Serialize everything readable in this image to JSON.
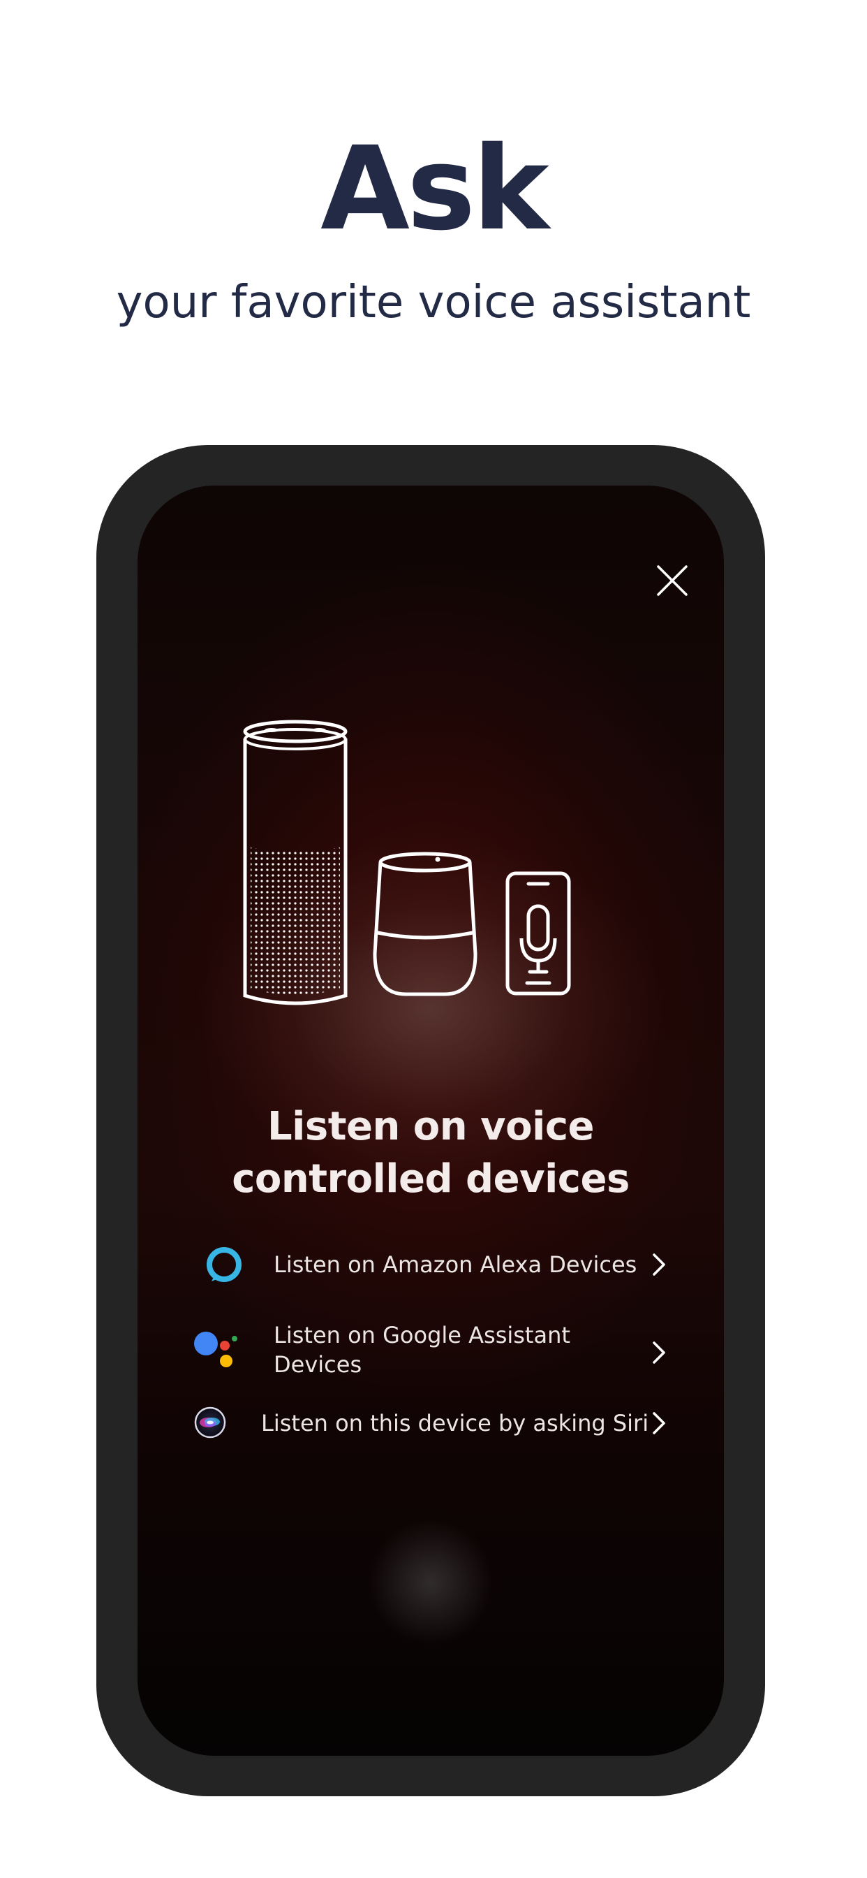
{
  "header": {
    "title": "Ask",
    "subtitle": "your favorite voice assistant"
  },
  "device_screen": {
    "title_line1": "Listen on voice",
    "title_line2": "controlled devices",
    "close_icon": "close-icon",
    "illustration_icons": [
      "smart-speaker-tall-icon",
      "smart-speaker-round-icon",
      "phone-microphone-icon"
    ],
    "options": [
      {
        "label": "Listen on Amazon Alexa Devices",
        "icon": "alexa-ring-icon"
      },
      {
        "label_line1": "Listen on Google Assistant",
        "label_line2": "Devices",
        "icon": "google-assistant-icon"
      },
      {
        "label": "Listen on this device by asking Siri",
        "icon": "siri-icon"
      }
    ],
    "chevron_icon": "chevron-right-icon"
  },
  "colors": {
    "heading": "#222a45",
    "phone_frame": "#242424",
    "alexa": "#37b6e6",
    "google_blue": "#4285f4",
    "google_red": "#ea4335",
    "google_yellow": "#fbbc05",
    "google_green": "#34a853"
  }
}
